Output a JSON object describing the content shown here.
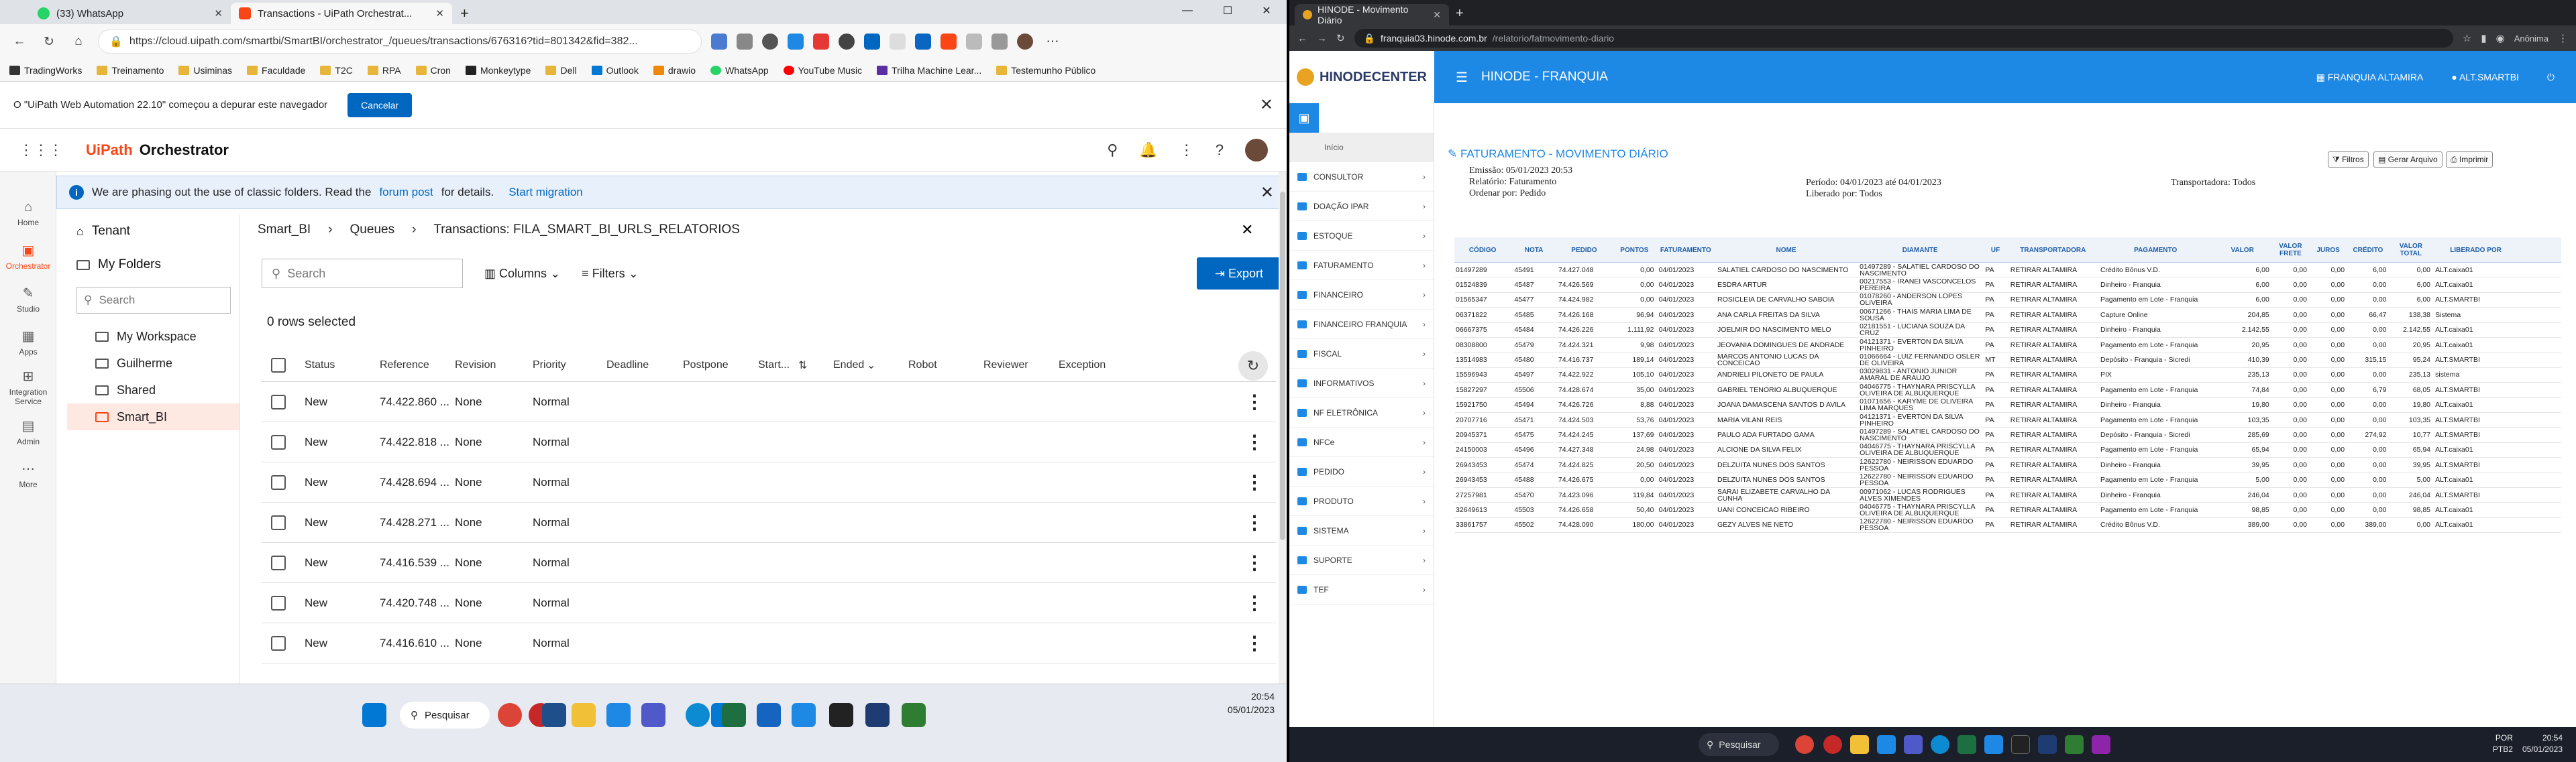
{
  "left_browser": {
    "tabs": [
      {
        "label": "(33) WhatsApp",
        "active": false
      },
      {
        "label": "Transactions - UiPath Orchestrat...",
        "active": true
      }
    ],
    "url": "https://cloud.uipath.com/smartbi/SmartBI/orchestrator_/queues/transactions/676316?tid=801342&fid=382...",
    "bookmarks": [
      "TradingWorks",
      "Treinamento",
      "Usiminas",
      "Faculdade",
      "T2C",
      "RPA",
      "Cron",
      "Monkeytype",
      "Dell",
      "Outlook",
      "drawio",
      "WhatsApp",
      "YouTube Music",
      "Trilha Machine Lear...",
      "Testemunho Público"
    ],
    "notice": {
      "text": "O \"UiPath Web Automation 22.10\" começou a depurar este navegador",
      "button": "Cancelar"
    }
  },
  "orchestrator": {
    "brand": "UiPath",
    "product": "Orchestrator",
    "nav": [
      {
        "label": "Home",
        "icon": "home-icon"
      },
      {
        "label": "Orchestrator",
        "icon": "orchestrator-icon",
        "selected": true
      },
      {
        "label": "Studio",
        "icon": "studio-icon"
      },
      {
        "label": "Apps",
        "icon": "apps-icon"
      },
      {
        "label": "Integration Service",
        "icon": "integration-icon"
      },
      {
        "label": "Admin",
        "icon": "admin-icon"
      },
      {
        "label": "More",
        "icon": "more-icon"
      }
    ],
    "banner": {
      "pre": "We are phasing out the use of classic folders. Read the",
      "link": "forum post",
      "mid": "for details.",
      "cta": "Start migration"
    },
    "tree": {
      "tenant": "Tenant",
      "my_folders": "My Folders",
      "search_placeholder": "Search",
      "items": [
        "My Workspace",
        "Guilherme",
        "Shared",
        "Smart_BI"
      ]
    },
    "breadcrumb": [
      "Smart_BI",
      "Queues",
      "Transactions: FILA_SMART_BI_URLS_RELATORIOS"
    ],
    "toolbar": {
      "search_placeholder": "Search",
      "columns": "Columns",
      "filters": "Filters",
      "export": "Export"
    },
    "selection": "0 rows selected",
    "columns": [
      "Status",
      "Reference",
      "Revision",
      "Priority",
      "Deadline",
      "Postpone",
      "Start...",
      "Ended",
      "Robot",
      "Reviewer",
      "Exception"
    ],
    "rows": [
      {
        "status": "New",
        "reference": "74.422.860 ...",
        "revision": "None",
        "priority": "Normal"
      },
      {
        "status": "New",
        "reference": "74.422.818 ...",
        "revision": "None",
        "priority": "Normal"
      },
      {
        "status": "New",
        "reference": "74.428.694 ...",
        "revision": "None",
        "priority": "Normal"
      },
      {
        "status": "New",
        "reference": "74.428.271 ...",
        "revision": "None",
        "priority": "Normal"
      },
      {
        "status": "New",
        "reference": "74.416.539 ...",
        "revision": "None",
        "priority": "Normal"
      },
      {
        "status": "New",
        "reference": "74.420.748 ...",
        "revision": "None",
        "priority": "Normal"
      },
      {
        "status": "New",
        "reference": "74.416.610 ...",
        "revision": "None",
        "priority": "Normal"
      }
    ]
  },
  "left_taskbar": {
    "search": "Pesquisar",
    "time": "20:54",
    "date": "05/01/2023"
  },
  "right_browser": {
    "tab": "HINODE - Movimento Diário",
    "url_host": "franquia03.hinode.com.br",
    "url_path": "/relatorio/fatmovimento-diario",
    "profile": "Anônima"
  },
  "hinode": {
    "logo": "HINODECENTER",
    "header_title": "HINODE - FRANQUIA",
    "header_links": [
      "FRANQUIA ALTAMIRA",
      "ALT.SMARTBI"
    ],
    "menu": [
      "Início",
      "CONSULTOR",
      "DOAÇÃO IPAR",
      "ESTOQUE",
      "FATURAMENTO",
      "FINANCEIRO",
      "FINANCEIRO FRANQUIA",
      "FISCAL",
      "INFORMATIVOS",
      "NF ELETRÔNICA",
      "NFCe",
      "PEDIDO",
      "PRODUTO",
      "SISTEMA",
      "SUPORTE",
      "TEF"
    ],
    "report_title": "FATURAMENTO - MOVIMENTO DIÁRIO",
    "meta": {
      "emissao": "Emissão: 05/01/2023 20:53",
      "relatorio": "Relatório: Faturamento",
      "ordenar": "Ordenar por: Pedido",
      "periodo": "Período: 04/01/2023 até 04/01/2023",
      "liberado": "Liberado por: Todos",
      "transportadora": "Transportadora: Todos"
    },
    "buttons": [
      "Filtros",
      "Gerar Arquivo",
      "Imprimir"
    ],
    "columns": [
      "CÓDIGO",
      "NOTA",
      "PEDIDO",
      "PONTOS",
      "FATURAMENTO",
      "NOME",
      "DIAMANTE",
      "UF",
      "TRANSPORTADORA",
      "PAGAMENTO",
      "VALOR",
      "VALOR FRETE",
      "JUROS",
      "CRÉDITO",
      "VALOR TOTAL",
      "LIBERADO POR"
    ],
    "rows": [
      [
        "01497289",
        "45491",
        "74.427.048",
        "0,00",
        "04/01/2023",
        "SALATIEL CARDOSO DO NASCIMENTO",
        "01497289 - SALATIEL CARDOSO DO NASCIMENTO",
        "PA",
        "RETIRAR ALTAMIRA",
        "Crédito Bônus V.D.",
        "6,00",
        "0,00",
        "0,00",
        "6,00",
        "0,00",
        "ALT.caixa01"
      ],
      [
        "01524839",
        "45487",
        "74.426.569",
        "0,00",
        "04/01/2023",
        "ESDRA ARTUR",
        "00217553 - IRANEI VASCONCELOS PEREIRA",
        "PA",
        "RETIRAR ALTAMIRA",
        "Dinheiro - Franquia",
        "6,00",
        "0,00",
        "0,00",
        "0,00",
        "6,00",
        "ALT.caixa01"
      ],
      [
        "01565347",
        "45477",
        "74.424.982",
        "0,00",
        "04/01/2023",
        "ROSICLEIA DE CARVALHO SABOIA",
        "01078260 - ANDERSON LOPES OLIVEIRA",
        "PA",
        "RETIRAR ALTAMIRA",
        "Pagamento em Lote - Franquia",
        "6,00",
        "0,00",
        "0,00",
        "0,00",
        "6,00",
        "ALT.SMARTBI"
      ],
      [
        "06371822",
        "45485",
        "74.426.168",
        "96,94",
        "04/01/2023",
        "ANA CARLA FREITAS DA SILVA",
        "00671266 - THAIS MARIA LIMA DE SOUSA",
        "PA",
        "RETIRAR ALTAMIRA",
        "Capture Online",
        "204,85",
        "0,00",
        "0,00",
        "66,47",
        "138,38",
        "Sistema"
      ],
      [
        "06667375",
        "45484",
        "74.426.226",
        "1.111,92",
        "04/01/2023",
        "JOELMIR DO NASCIMENTO MELO",
        "02181551 - LUCIANA SOUZA DA CRUZ",
        "PA",
        "RETIRAR ALTAMIRA",
        "Dinheiro - Franquia",
        "2.142,55",
        "0,00",
        "0,00",
        "0,00",
        "2.142,55",
        "ALT.caixa01"
      ],
      [
        "08308800",
        "45479",
        "74.424.321",
        "9,98",
        "04/01/2023",
        "JEOVANIA DOMINGUES DE ANDRADE",
        "04121371 - EVERTON DA SILVA PINHEIRO",
        "PA",
        "RETIRAR ALTAMIRA",
        "Pagamento em Lote - Franquia",
        "20,95",
        "0,00",
        "0,00",
        "0,00",
        "20,95",
        "ALT.caixa01"
      ],
      [
        "13514983",
        "45480",
        "74.416.737",
        "189,14",
        "04/01/2023",
        "MARCOS ANTONIO LUCAS DA CONCEICAO",
        "01066664 - LUIZ FERNANDO OSLER DE OLIVEIRA",
        "MT",
        "RETIRAR ALTAMIRA",
        "Depósito - Franquia - Sicredi",
        "410,39",
        "0,00",
        "0,00",
        "315,15",
        "95,24",
        "ALT.SMARTBI"
      ],
      [
        "15596943",
        "45497",
        "74.422.922",
        "105,10",
        "04/01/2023",
        "ANDRIELI PILONETO DE PAULA",
        "03029831 - ANTONIO JUNIOR AMARAL DE ARAUJO",
        "PA",
        "RETIRAR ALTAMIRA",
        "PIX",
        "235,13",
        "0,00",
        "0,00",
        "0,00",
        "235,13",
        "sistema"
      ],
      [
        "15827297",
        "45506",
        "74.428.674",
        "35,00",
        "04/01/2023",
        "GABRIEL TENORIO ALBUQUERQUE",
        "04046775 - THAYNARA PRISCYLLA OLIVEIRA DE ALBUQUERQUE",
        "PA",
        "RETIRAR ALTAMIRA",
        "Pagamento em Lote - Franquia",
        "74,84",
        "0,00",
        "0,00",
        "6,79",
        "68,05",
        "ALT.SMARTBI"
      ],
      [
        "15921750",
        "45494",
        "74.426.726",
        "8,88",
        "04/01/2023",
        "JOANA DAMASCENA SANTOS D AVILA",
        "01071656 - KARYME DE OLIVEIRA LIMA MARQUES",
        "PA",
        "RETIRAR ALTAMIRA",
        "Dinheiro - Franquia",
        "19,80",
        "0,00",
        "0,00",
        "0,00",
        "19,80",
        "ALT.caixa01"
      ],
      [
        "20707716",
        "45471",
        "74.424.503",
        "53,76",
        "04/01/2023",
        "MARIA VILANI REIS",
        "04121371 - EVERTON DA SILVA PINHEIRO",
        "PA",
        "RETIRAR ALTAMIRA",
        "Pagamento em Lote - Franquia",
        "103,35",
        "0,00",
        "0,00",
        "0,00",
        "103,35",
        "ALT.SMARTBI"
      ],
      [
        "20945371",
        "45475",
        "74.424.245",
        "137,69",
        "04/01/2023",
        "PAULO ADA FURTADO GAMA",
        "01497289 - SALATIEL CARDOSO DO NASCIMENTO",
        "PA",
        "RETIRAR ALTAMIRA",
        "Depósito - Franquia - Sicredi",
        "285,69",
        "0,00",
        "0,00",
        "274,92",
        "10,77",
        "ALT.SMARTBI"
      ],
      [
        "24150003",
        "45496",
        "74.427.348",
        "24,98",
        "04/01/2023",
        "ALCIONE DA SILVA FELIX",
        "04046775 - THAYNARA PRISCYLLA OLIVEIRA DE ALBUQUERQUE",
        "PA",
        "RETIRAR ALTAMIRA",
        "Pagamento em Lote - Franquia",
        "65,94",
        "0,00",
        "0,00",
        "0,00",
        "65,94",
        "ALT.caixa01"
      ],
      [
        "26943453",
        "45474",
        "74.424.825",
        "20,50",
        "04/01/2023",
        "DELZUITA NUNES DOS SANTOS",
        "12622780 - NEIRISSON EDUARDO PESSOA",
        "PA",
        "RETIRAR ALTAMIRA",
        "Dinheiro - Franquia",
        "39,95",
        "0,00",
        "0,00",
        "0,00",
        "39,95",
        "ALT.SMARTBI"
      ],
      [
        "26943453",
        "45488",
        "74.426.675",
        "0,00",
        "04/01/2023",
        "DELZUITA NUNES DOS SANTOS",
        "12622780 - NEIRISSON EDUARDO PESSOA",
        "PA",
        "RETIRAR ALTAMIRA",
        "Pagamento em Lote - Franquia",
        "5,00",
        "0,00",
        "0,00",
        "0,00",
        "5,00",
        "ALT.caixa01"
      ],
      [
        "27257981",
        "45470",
        "74.423.096",
        "119,84",
        "04/01/2023",
        "SARAI ELIZABETE CARVALHO DA CUNHA",
        "00971062 - LUCAS RODRIGUES ALVES XIMENDES",
        "PA",
        "RETIRAR ALTAMIRA",
        "Dinheiro - Franquia",
        "246,04",
        "0,00",
        "0,00",
        "0,00",
        "246,04",
        "ALT.SMARTBI"
      ],
      [
        "32649613",
        "45503",
        "74.426.658",
        "50,40",
        "04/01/2023",
        "UANI CONCEICAO RIBEIRO",
        "04046775 - THAYNARA PRISCYLLA OLIVEIRA DE ALBUQUERQUE",
        "PA",
        "RETIRAR ALTAMIRA",
        "Pagamento em Lote - Franquia",
        "98,85",
        "0,00",
        "0,00",
        "0,00",
        "98,85",
        "ALT.caixa01"
      ],
      [
        "33861757",
        "45502",
        "74.428.090",
        "180,00",
        "04/01/2023",
        "GEZY ALVES NE NETO",
        "12622780 - NEIRISSON EDUARDO PESSOA",
        "PA",
        "RETIRAR ALTAMIRA",
        "Crédito Bônus V.D.",
        "389,00",
        "0,00",
        "0,00",
        "389,00",
        "0,00",
        "ALT.caixa01"
      ]
    ]
  },
  "right_taskbar": {
    "search": "Pesquisar",
    "lang": "POR PTB2",
    "time": "20:54",
    "date": "05/01/2023"
  }
}
